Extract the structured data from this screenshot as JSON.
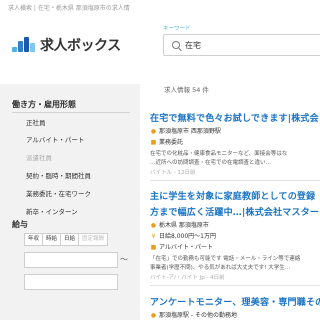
{
  "breadcrumb": "求人横索 | 在宅・栃木県 那須塩原市の求人情",
  "logo": {
    "text": "求人ボックス",
    "colors": [
      "#4ab0e6",
      "#2d7fd0",
      "#1a5aa8",
      "#7fc6ee"
    ]
  },
  "search": {
    "label": "キーワード",
    "value": "在宅"
  },
  "sidebar": {
    "work_style_heading": "働き方・雇用形態",
    "work_styles": [
      {
        "label": "正社員",
        "enabled": true
      },
      {
        "label": "アルバイト・パート",
        "enabled": true
      },
      {
        "label": "派遣社員",
        "enabled": false
      },
      {
        "label": "契約・臨時・期間社員",
        "enabled": true
      },
      {
        "label": "業務委託・在宅ワーク",
        "enabled": true
      },
      {
        "label": "新卒・インターン",
        "enabled": true
      }
    ],
    "salary_heading": "給与",
    "salary_tabs": [
      {
        "label": "年収",
        "enabled": true
      },
      {
        "label": "時給",
        "enabled": true
      },
      {
        "label": "日給",
        "enabled": true
      },
      {
        "label": "固定報酬",
        "enabled": false
      }
    ],
    "range_separator": "〜"
  },
  "results": {
    "count_text": "求人情報 54 件",
    "jobs": [
      {
        "title": "在宅で無料で色々お試しできます|株式会",
        "location": "那須塩原市 西那須野駅",
        "type": "業務委託",
        "desc1": "在宅での化粧品・健康食品モニターなど、面接会等はな",
        "desc2": "…近所への訪問調査・在宅での在電調査と違い…",
        "meta": "バイトル - 12日前"
      },
      {
        "title_line1": "主に学生を対象に家庭教師としての登録",
        "title_line2": "方まで幅広く活躍中…|株式会社マスター",
        "location": "栃木県 那須塩原市",
        "salary": "日給8,000円〜1万円",
        "type": "アルバイト・パート",
        "desc1": "「在宅」での勤務も可能です 電話・メール・ライン等で連絡",
        "desc2": "事業者(学歴不問)、やる気があれば大丈夫です! 大学生…",
        "meta": "バイト-ア/・バイト Jp - 4日前"
      },
      {
        "title": "アンケートモニター、理美容・専門職その",
        "location": "那須塩原駅 - その他の勤務地"
      }
    ]
  }
}
